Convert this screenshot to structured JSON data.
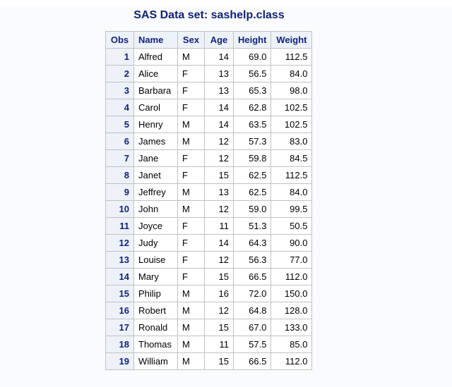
{
  "title": "SAS Data set: sashelp.class",
  "table": {
    "headers": {
      "obs": "Obs",
      "name": "Name",
      "sex": "Sex",
      "age": "Age",
      "height": "Height",
      "weight": "Weight"
    },
    "rows": [
      {
        "obs": "1",
        "name": "Alfred",
        "sex": "M",
        "age": "14",
        "height": "69.0",
        "weight": "112.5"
      },
      {
        "obs": "2",
        "name": "Alice",
        "sex": "F",
        "age": "13",
        "height": "56.5",
        "weight": "84.0"
      },
      {
        "obs": "3",
        "name": "Barbara",
        "sex": "F",
        "age": "13",
        "height": "65.3",
        "weight": "98.0"
      },
      {
        "obs": "4",
        "name": "Carol",
        "sex": "F",
        "age": "14",
        "height": "62.8",
        "weight": "102.5"
      },
      {
        "obs": "5",
        "name": "Henry",
        "sex": "M",
        "age": "14",
        "height": "63.5",
        "weight": "102.5"
      },
      {
        "obs": "6",
        "name": "James",
        "sex": "M",
        "age": "12",
        "height": "57.3",
        "weight": "83.0"
      },
      {
        "obs": "7",
        "name": "Jane",
        "sex": "F",
        "age": "12",
        "height": "59.8",
        "weight": "84.5"
      },
      {
        "obs": "8",
        "name": "Janet",
        "sex": "F",
        "age": "15",
        "height": "62.5",
        "weight": "112.5"
      },
      {
        "obs": "9",
        "name": "Jeffrey",
        "sex": "M",
        "age": "13",
        "height": "62.5",
        "weight": "84.0"
      },
      {
        "obs": "10",
        "name": "John",
        "sex": "M",
        "age": "12",
        "height": "59.0",
        "weight": "99.5"
      },
      {
        "obs": "11",
        "name": "Joyce",
        "sex": "F",
        "age": "11",
        "height": "51.3",
        "weight": "50.5"
      },
      {
        "obs": "12",
        "name": "Judy",
        "sex": "F",
        "age": "14",
        "height": "64.3",
        "weight": "90.0"
      },
      {
        "obs": "13",
        "name": "Louise",
        "sex": "F",
        "age": "12",
        "height": "56.3",
        "weight": "77.0"
      },
      {
        "obs": "14",
        "name": "Mary",
        "sex": "F",
        "age": "15",
        "height": "66.5",
        "weight": "112.0"
      },
      {
        "obs": "15",
        "name": "Philip",
        "sex": "M",
        "age": "16",
        "height": "72.0",
        "weight": "150.0"
      },
      {
        "obs": "16",
        "name": "Robert",
        "sex": "M",
        "age": "12",
        "height": "64.8",
        "weight": "128.0"
      },
      {
        "obs": "17",
        "name": "Ronald",
        "sex": "M",
        "age": "15",
        "height": "67.0",
        "weight": "133.0"
      },
      {
        "obs": "18",
        "name": "Thomas",
        "sex": "M",
        "age": "11",
        "height": "57.5",
        "weight": "85.0"
      },
      {
        "obs": "19",
        "name": "William",
        "sex": "M",
        "age": "15",
        "height": "66.5",
        "weight": "112.0"
      }
    ]
  },
  "colors": {
    "title_text": "#112277",
    "header_bg": "#edf2f9",
    "page_bg": "#fafbfe",
    "border": "#c1c1c1"
  }
}
